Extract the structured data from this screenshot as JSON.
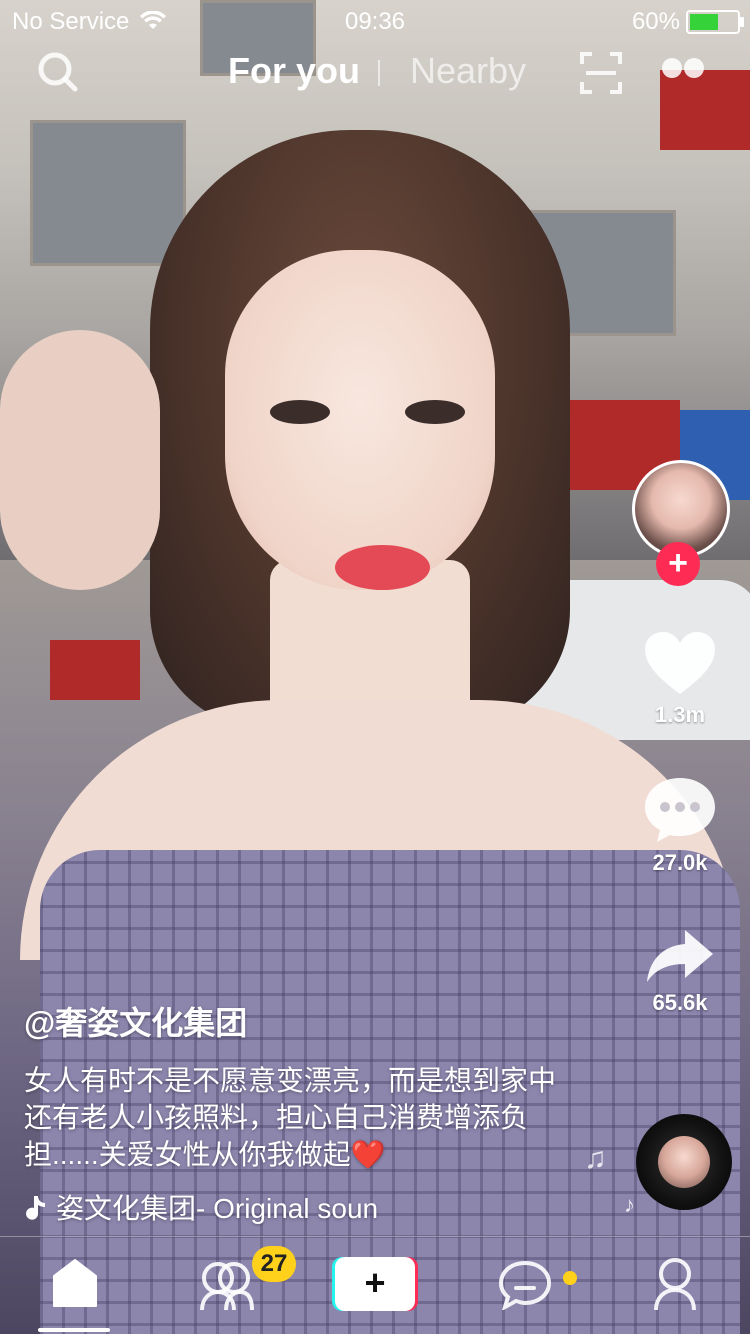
{
  "status_bar": {
    "carrier": "No Service",
    "time": "09:36",
    "battery": "60%",
    "battery_level": 0.6,
    "battery_color": "#35d23a"
  },
  "top_nav": {
    "tabs": [
      {
        "label": "For you",
        "active": true
      },
      {
        "label": "Nearby",
        "active": false
      }
    ]
  },
  "actions": {
    "likes": "1.3m",
    "comments": "27.0k",
    "shares": "65.6k",
    "follow_symbol": "+",
    "accent": "#fe2c55"
  },
  "caption": {
    "username": "@奢姿文化集团",
    "description": "女人有时不是不愿意变漂亮，而是想到家中还有老人小孩照料，担心自己消费增添负担......关爱女性从你我做起❤️",
    "sound": "姿文化集团- Original soun"
  },
  "bottom_nav": {
    "friends_badge": "27",
    "create_symbol": "+",
    "badge_color": "#ffd11a"
  }
}
